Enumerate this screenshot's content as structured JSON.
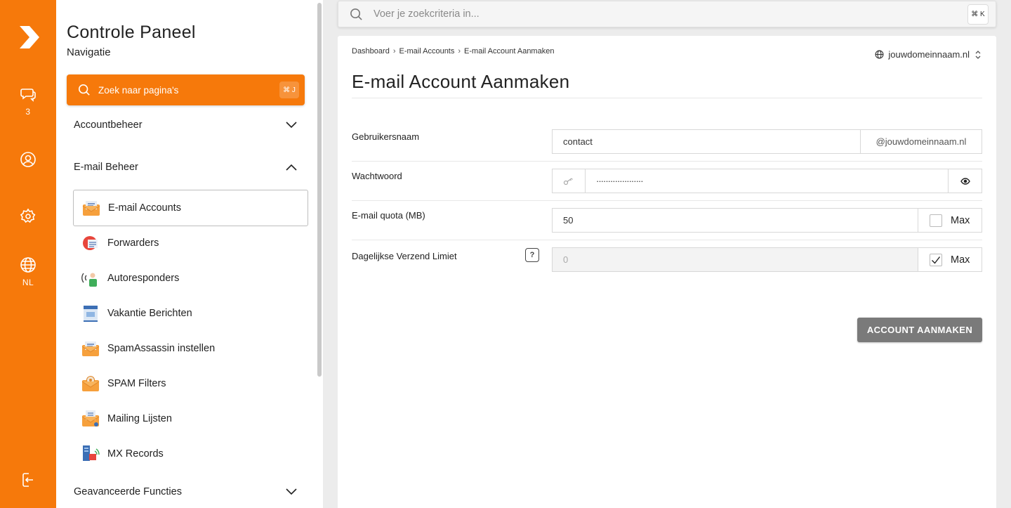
{
  "rail": {
    "brand_icon": "chevron-logo-icon",
    "chat_count": "3",
    "language": "NL"
  },
  "sidebar": {
    "title": "Controle Paneel",
    "subtitle": "Navigatie",
    "search_placeholder": "Zoek naar pagina's",
    "search_shortcut": "⌘ J",
    "sections": {
      "account": "Accountbeheer",
      "email": "E-mail Beheer",
      "advanced": "Geavanceerde Functies"
    },
    "email_items": [
      {
        "label": "E-mail Accounts",
        "icon": "email-envelope-icon"
      },
      {
        "label": "Forwarders",
        "icon": "forwarder-icon"
      },
      {
        "label": "Autoresponders",
        "icon": "autoresponder-icon"
      },
      {
        "label": "Vakantie Berichten",
        "icon": "vacation-message-icon"
      },
      {
        "label": "SpamAssassin instellen",
        "icon": "spamassassin-icon"
      },
      {
        "label": "SPAM Filters",
        "icon": "spam-filter-icon"
      },
      {
        "label": "Mailing Lijsten",
        "icon": "mailing-list-icon"
      },
      {
        "label": "MX Records",
        "icon": "mx-records-icon"
      }
    ]
  },
  "topbar": {
    "search_placeholder": "Voer je zoekcriteria in...",
    "shortcut": "⌘ K"
  },
  "breadcrumb": [
    "Dashboard",
    "E-mail Accounts",
    "E-mail Account Aanmaken"
  ],
  "domain_selector": "jouwdomeinnaam.nl",
  "page_title": "E-mail Account Aanmaken",
  "form": {
    "username": {
      "label": "Gebruikersnaam",
      "value": "contact",
      "suffix": "@jouwdomeinnaam.nl"
    },
    "password": {
      "label": "Wachtwoord",
      "value": "····················"
    },
    "quota": {
      "label": "E-mail quota (MB)",
      "value": "50",
      "max_label": "Max",
      "max_checked": false
    },
    "send_limit": {
      "label": "Dagelijkse Verzend Limiet",
      "value": "0",
      "max_label": "Max",
      "max_checked": true,
      "help": "?"
    },
    "submit": "ACCOUNT AANMAKEN"
  },
  "colors": {
    "accent": "#f6790b",
    "button": "#7a7a7a"
  }
}
